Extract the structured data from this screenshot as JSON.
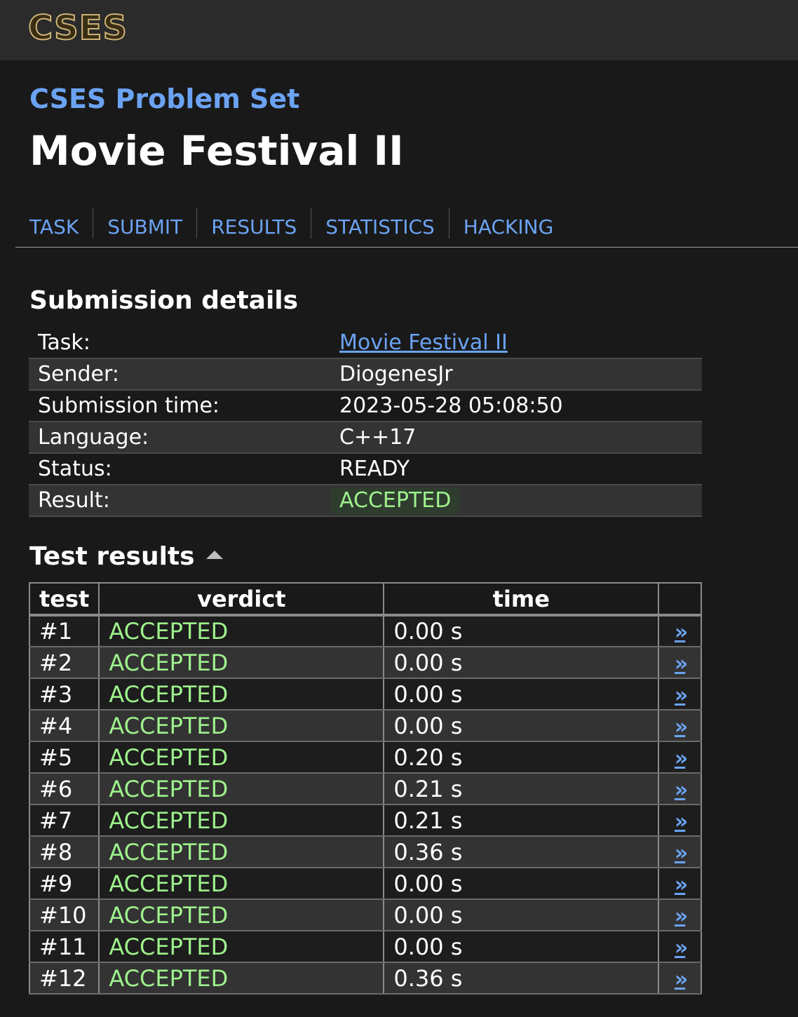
{
  "header": {
    "logo_text": "CSES"
  },
  "site_title": "CSES Problem Set",
  "page_title": "Movie Festival II",
  "nav": {
    "items": [
      "TASK",
      "SUBMIT",
      "RESULTS",
      "STATISTICS",
      "HACKING"
    ]
  },
  "submission": {
    "heading": "Submission details",
    "rows": [
      {
        "label": "Task:",
        "value": "Movie Festival II"
      },
      {
        "label": "Sender:",
        "value": "DiogenesJr"
      },
      {
        "label": "Submission time:",
        "value": "2023-05-28 05:08:50"
      },
      {
        "label": "Language:",
        "value": "C++17"
      },
      {
        "label": "Status:",
        "value": "READY"
      },
      {
        "label": "Result:",
        "value": "ACCEPTED"
      }
    ]
  },
  "tests": {
    "heading": "Test results",
    "columns": {
      "test": "test",
      "verdict": "verdict",
      "time": "time",
      "link": ""
    },
    "link_glyph": "»",
    "rows": [
      {
        "test": "#1",
        "verdict": "ACCEPTED",
        "time": "0.00 s"
      },
      {
        "test": "#2",
        "verdict": "ACCEPTED",
        "time": "0.00 s"
      },
      {
        "test": "#3",
        "verdict": "ACCEPTED",
        "time": "0.00 s"
      },
      {
        "test": "#4",
        "verdict": "ACCEPTED",
        "time": "0.00 s"
      },
      {
        "test": "#5",
        "verdict": "ACCEPTED",
        "time": "0.20 s"
      },
      {
        "test": "#6",
        "verdict": "ACCEPTED",
        "time": "0.21 s"
      },
      {
        "test": "#7",
        "verdict": "ACCEPTED",
        "time": "0.21 s"
      },
      {
        "test": "#8",
        "verdict": "ACCEPTED",
        "time": "0.36 s"
      },
      {
        "test": "#9",
        "verdict": "ACCEPTED",
        "time": "0.00 s"
      },
      {
        "test": "#10",
        "verdict": "ACCEPTED",
        "time": "0.00 s"
      },
      {
        "test": "#11",
        "verdict": "ACCEPTED",
        "time": "0.00 s"
      },
      {
        "test": "#12",
        "verdict": "ACCEPTED",
        "time": "0.36 s"
      }
    ]
  },
  "colors": {
    "link": "#6ba3f2",
    "accepted": "#9ef28c",
    "background": "#191919",
    "header_bg": "#2b2b2b"
  }
}
